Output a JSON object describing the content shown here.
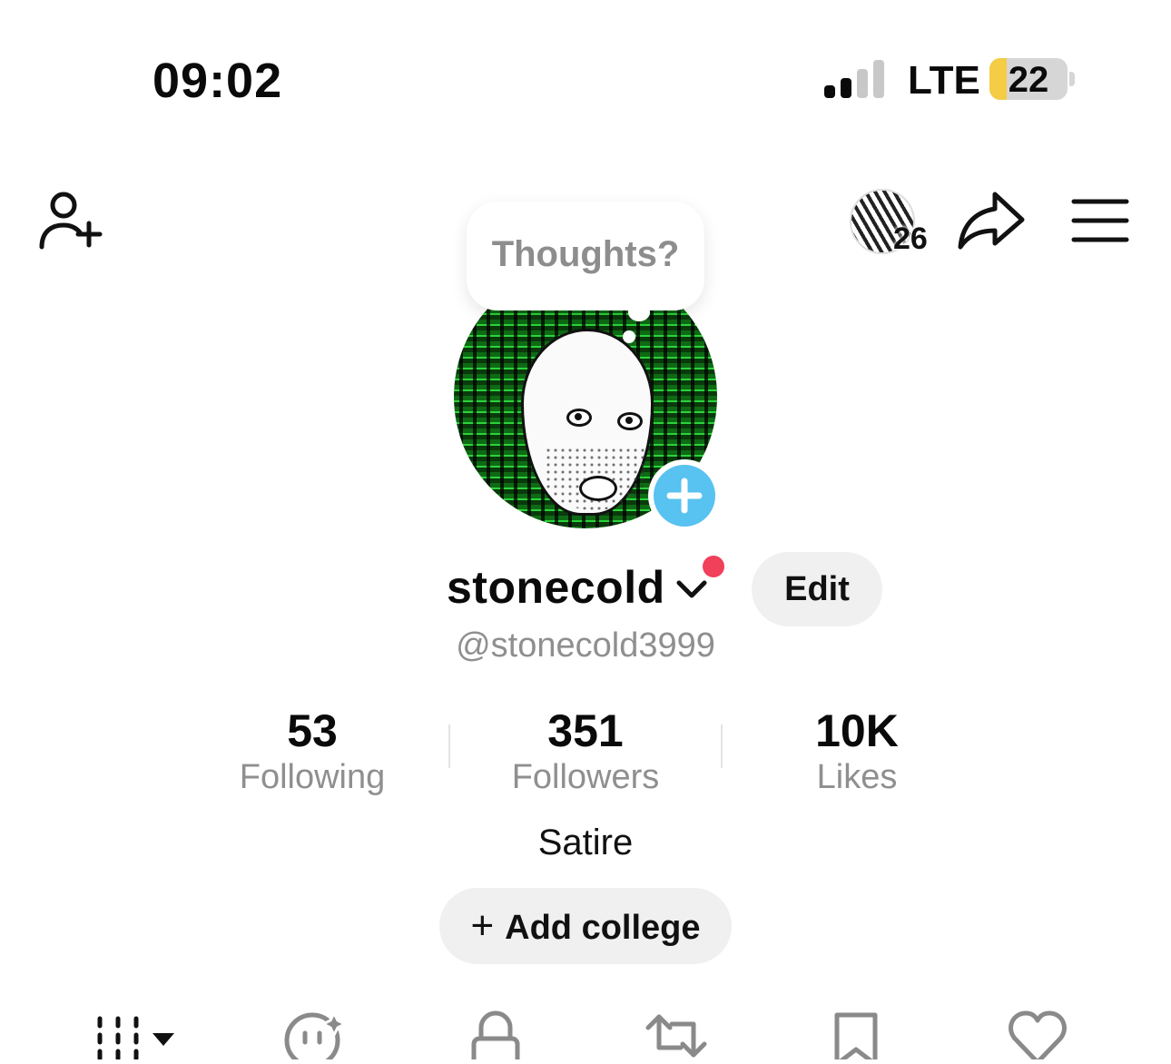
{
  "status_bar": {
    "time": "09:02",
    "network": "LTE",
    "battery_level": "22",
    "signal_bars_active": 2,
    "signal_bars_total": 4
  },
  "top_bar": {
    "profile_viewers_count": "26",
    "icons": [
      "add-friend-icon",
      "profile-viewers-avatar",
      "share-icon",
      "menu-icon"
    ]
  },
  "note_bubble": {
    "placeholder": "Thoughts?"
  },
  "profile": {
    "display_name": "stonecold",
    "handle": "@stonecold3999",
    "edit_label": "Edit",
    "bio": "Satire",
    "add_college_label": "Add college"
  },
  "stats": [
    {
      "value": "53",
      "label": "Following"
    },
    {
      "value": "351",
      "label": "Followers"
    },
    {
      "value": "10K",
      "label": "Likes"
    }
  ],
  "tabs": [
    {
      "icon": "grid-icon"
    },
    {
      "icon": "ai-self-icon"
    },
    {
      "icon": "lock-icon"
    },
    {
      "icon": "repost-icon"
    },
    {
      "icon": "bookmark-icon"
    },
    {
      "icon": "heart-icon"
    }
  ],
  "colors": {
    "accent_blue": "#58c2f0",
    "notification_red": "#f0405a",
    "battery_yellow": "#f4cc45",
    "muted_text": "#8f8f8f",
    "button_bg": "#f0f0f0"
  }
}
